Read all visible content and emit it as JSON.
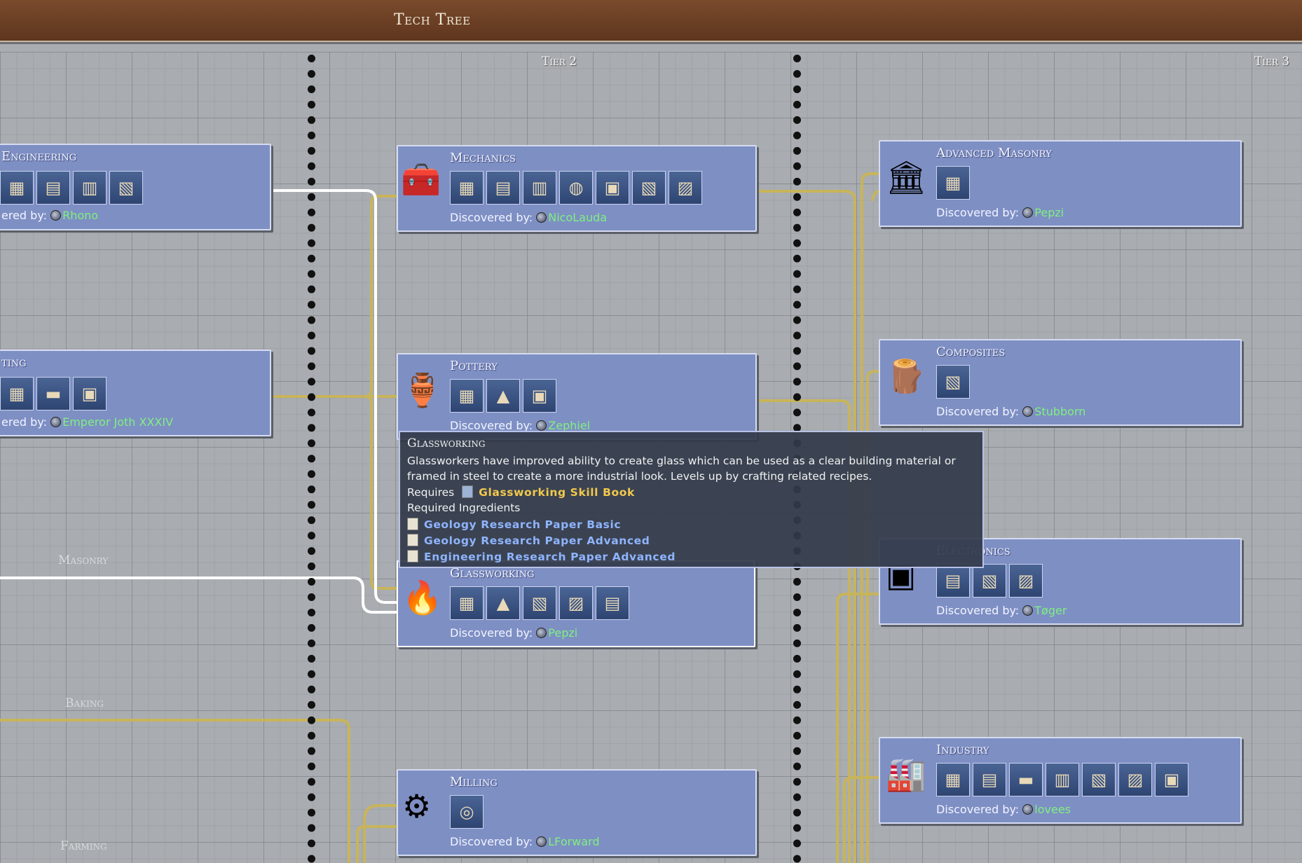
{
  "window": {
    "title": "Tech Tree"
  },
  "tiers": [
    {
      "label": "Tier 2"
    },
    {
      "label": "Tier 3"
    }
  ],
  "categories": {
    "masonry": "Masonry",
    "baking": "Baking",
    "farming": "Farming"
  },
  "cards": {
    "engineering": {
      "title": "Engineering",
      "discovered_prefix": "ered by:",
      "user": "Rhono",
      "icons": [
        "crafting-table-icon",
        "workbench-icon",
        "sawmill-icon",
        "carpentry-table-icon"
      ]
    },
    "smelting": {
      "title": "ting",
      "discovered_prefix": "ered by:",
      "user": "Emperor Joth XXXIV",
      "icons": [
        "bloomery-icon",
        "anvil-icon",
        "furnace-icon"
      ]
    },
    "mechanics": {
      "title": "Mechanics",
      "discovered_prefix": "Discovered by:",
      "user": "NicoLauda",
      "icons": [
        "machine-shop-icon",
        "assembly-icon",
        "lathe-icon",
        "drum-icon",
        "boiler-icon",
        "engine-icon",
        "press-icon"
      ]
    },
    "pottery": {
      "title": "Pottery",
      "discovered_prefix": "Discovered by:",
      "user": "Zephiel",
      "icons": [
        "pottery-wheel-icon",
        "kiln-icon",
        "brick-oven-icon"
      ]
    },
    "glassworking": {
      "title": "Glassworking",
      "discovered_prefix": "Discovered by:",
      "user": "Pepzi",
      "icons": [
        "glass-bench-icon",
        "glass-kiln-icon",
        "torch-machine-icon",
        "grinder-icon",
        "lab-icon"
      ]
    },
    "milling": {
      "title": "Milling",
      "discovered_prefix": "Discovered by:",
      "user": "LForward",
      "icons": [
        "millstone-icon"
      ]
    },
    "advanced_masonry": {
      "title": "Advanced Masonry",
      "discovered_prefix": "Discovered by:",
      "user": "Pepzi",
      "icons": [
        "mason-table-icon"
      ]
    },
    "composites": {
      "title": "Composites",
      "discovered_prefix": "Discovered by:",
      "user": "Stubborn",
      "icons": [
        "composite-press-icon"
      ]
    },
    "electronics": {
      "title": "Electronics",
      "discovered_prefix": "Discovered by:",
      "user": "Tøger",
      "icons": [
        "electronics-desk-icon",
        "circuit-machine-icon",
        "robot-arm-icon"
      ]
    },
    "industry": {
      "title": "Industry",
      "discovered_prefix": "Discovered by:",
      "user": "lovees",
      "icons": [
        "assembly-line-icon",
        "generator-icon",
        "conveyor-icon",
        "green-machine-icon",
        "loader-icon",
        "tractor-icon",
        "computer-lab-icon"
      ]
    }
  },
  "tooltip": {
    "title": "Glassworking",
    "description": "Glassworkers have improved ability to create glass which can be used as a clear building material or framed in steel to create a more industrial look. Levels up by crafting related recipes.",
    "requires_label": "Requires",
    "skill_book": "Glassworking Skill Book",
    "ingredients_label": "Required Ingredients",
    "ingredients": [
      "Geology Research Paper Basic",
      "Geology Research Paper Advanced",
      "Engineering Research Paper Advanced"
    ]
  },
  "colors": {
    "card": "#7e8fc4",
    "wire": "#c8b45a",
    "wire_highlight": "#ffffff",
    "discoverer": "#7ff07f",
    "ingredient": "#8fb4ff",
    "book": "#f2c94c"
  }
}
